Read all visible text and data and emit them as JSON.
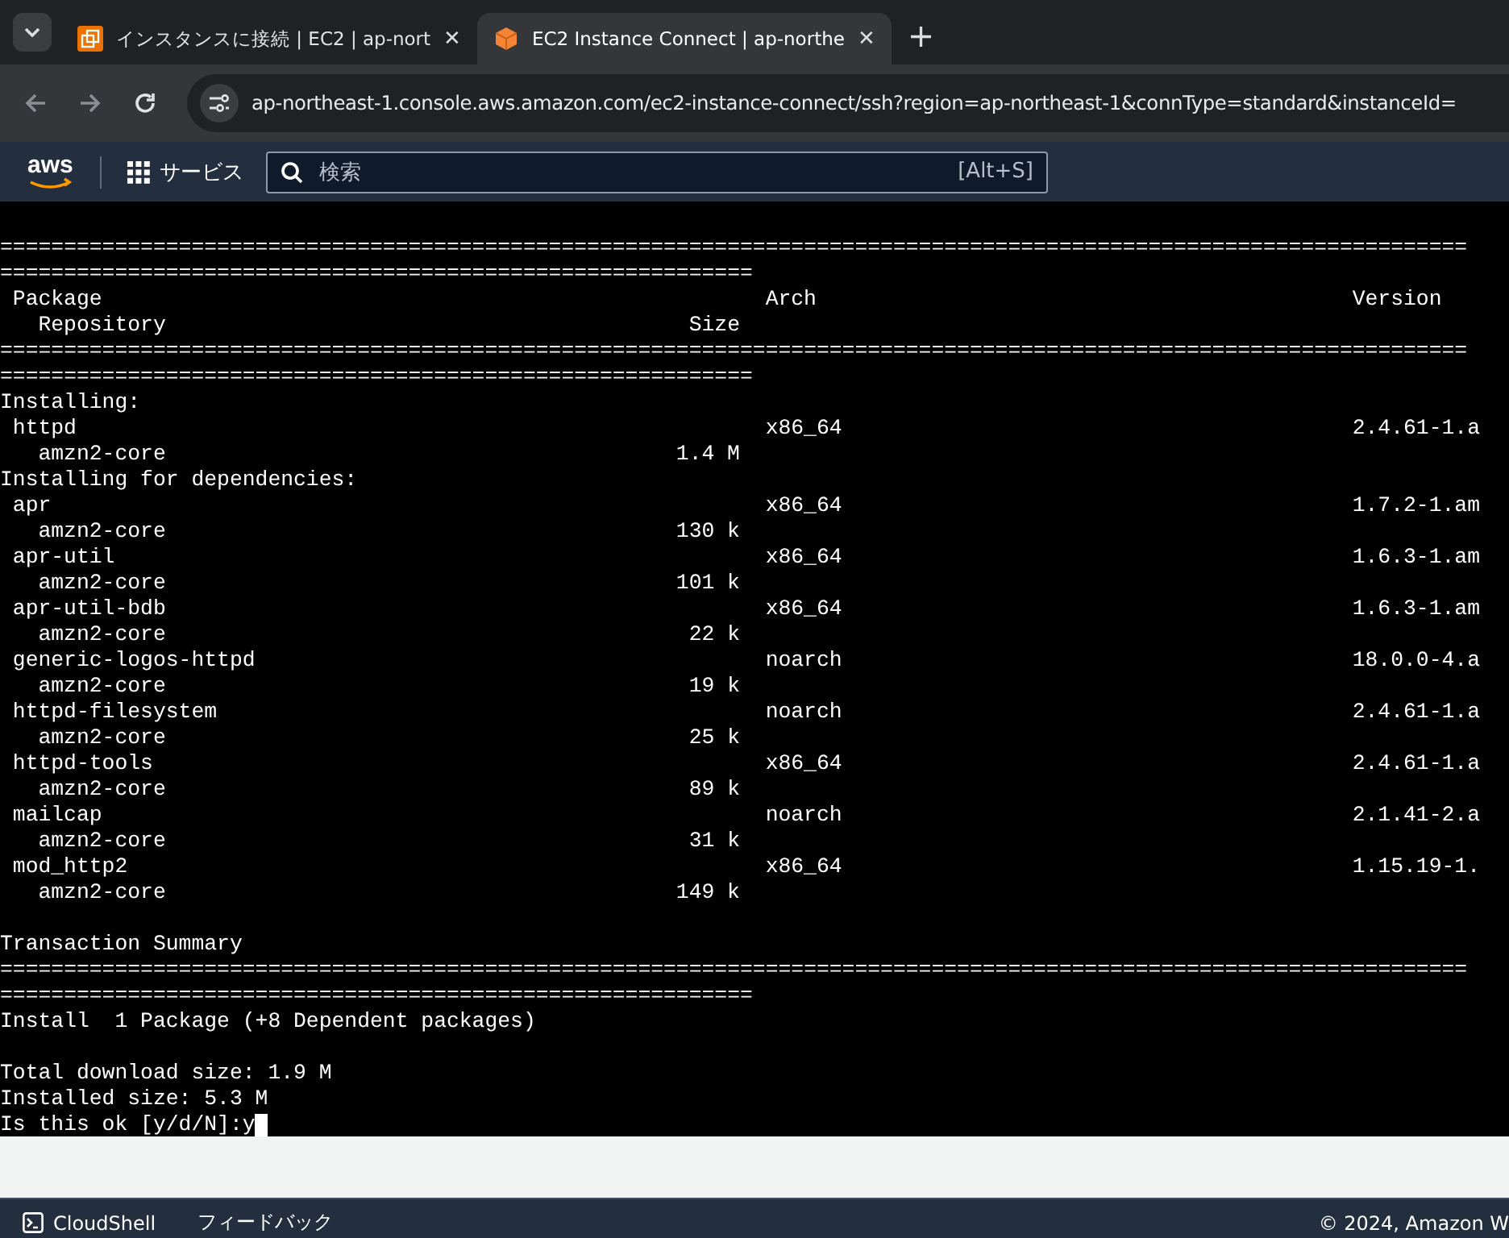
{
  "tabs": [
    {
      "title": "インスタンスに接続 | EC2 | ap-nort",
      "selected": false,
      "close": "✕"
    },
    {
      "title": "EC2 Instance Connect | ap-northe",
      "selected": true,
      "close": "✕"
    }
  ],
  "new_tab": "+",
  "address_bar": {
    "url": "ap-northeast-1.console.aws.amazon.com/ec2-instance-connect/ssh?region=ap-northeast-1&connType=standard&instanceId="
  },
  "aws_nav": {
    "logo": "aws",
    "services": "サービス",
    "search": {
      "placeholder": "検索",
      "shortcut": "[Alt+S]"
    }
  },
  "terminal": {
    "lines": [
      {
        "kind": "blank"
      },
      {
        "kind": "rule",
        "text": "==================================================================================================================="
      },
      {
        "kind": "rule",
        "text": "==========================================================="
      },
      {
        "kind": "row",
        "name": "Package",
        "arch": "Arch",
        "version": "Version"
      },
      {
        "kind": "sub",
        "repository": "Repository",
        "size": "Size"
      },
      {
        "kind": "rule",
        "text": "==================================================================================================================="
      },
      {
        "kind": "rule",
        "text": "==========================================================="
      },
      {
        "kind": "text",
        "text": "Installing:"
      },
      {
        "kind": "row",
        "name": "httpd",
        "arch": "x86_64",
        "version": "2.4.61-1.a"
      },
      {
        "kind": "sub",
        "repository": "amzn2-core",
        "size": "1.4 M"
      },
      {
        "kind": "text",
        "text": "Installing for dependencies:"
      },
      {
        "kind": "row",
        "name": "apr",
        "arch": "x86_64",
        "version": "1.7.2-1.am"
      },
      {
        "kind": "sub",
        "repository": "amzn2-core",
        "size": "130 k"
      },
      {
        "kind": "row",
        "name": "apr-util",
        "arch": "x86_64",
        "version": "1.6.3-1.am"
      },
      {
        "kind": "sub",
        "repository": "amzn2-core",
        "size": "101 k"
      },
      {
        "kind": "row",
        "name": "apr-util-bdb",
        "arch": "x86_64",
        "version": "1.6.3-1.am"
      },
      {
        "kind": "sub",
        "repository": "amzn2-core",
        "size": "22 k"
      },
      {
        "kind": "row",
        "name": "generic-logos-httpd",
        "arch": "noarch",
        "version": "18.0.0-4.a"
      },
      {
        "kind": "sub",
        "repository": "amzn2-core",
        "size": "19 k"
      },
      {
        "kind": "row",
        "name": "httpd-filesystem",
        "arch": "noarch",
        "version": "2.4.61-1.a"
      },
      {
        "kind": "sub",
        "repository": "amzn2-core",
        "size": "25 k"
      },
      {
        "kind": "row",
        "name": "httpd-tools",
        "arch": "x86_64",
        "version": "2.4.61-1.a"
      },
      {
        "kind": "sub",
        "repository": "amzn2-core",
        "size": "89 k"
      },
      {
        "kind": "row",
        "name": "mailcap",
        "arch": "noarch",
        "version": "2.1.41-2.a"
      },
      {
        "kind": "sub",
        "repository": "amzn2-core",
        "size": "31 k"
      },
      {
        "kind": "row",
        "name": "mod_http2",
        "arch": "x86_64",
        "version": "1.15.19-1."
      },
      {
        "kind": "sub",
        "repository": "amzn2-core",
        "size": "149 k"
      },
      {
        "kind": "blank"
      },
      {
        "kind": "text",
        "text": "Transaction Summary"
      },
      {
        "kind": "rule",
        "text": "==================================================================================================================="
      },
      {
        "kind": "rule",
        "text": "==========================================================="
      },
      {
        "kind": "text",
        "text": "Install  1 Package (+8 Dependent packages)"
      },
      {
        "kind": "blank"
      },
      {
        "kind": "text",
        "text": "Total download size: 1.9 M"
      },
      {
        "kind": "text",
        "text": "Installed size: 5.3 M"
      },
      {
        "kind": "prompt",
        "text": "Is this ok [y/d/N]:",
        "input": "y"
      }
    ]
  },
  "footer": {
    "cloudshell": "CloudShell",
    "feedback": "フィードバック",
    "copyright": "© 2024, Amazon W"
  }
}
